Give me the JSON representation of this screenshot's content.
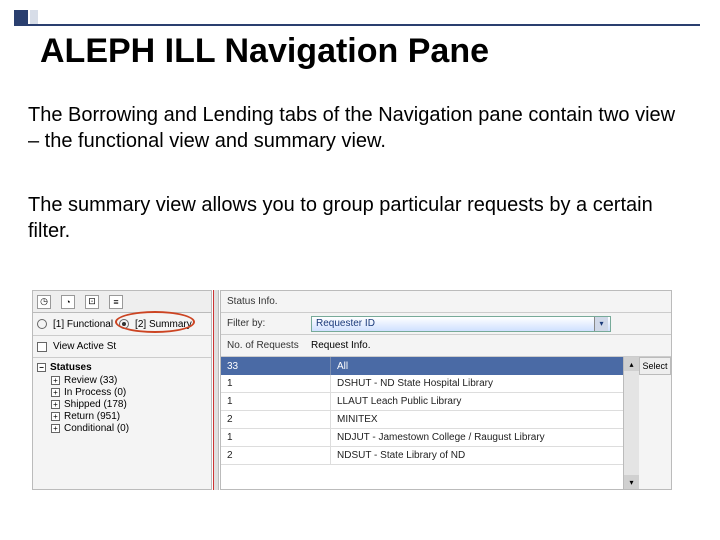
{
  "title": "ALEPH ILL  Navigation Pane",
  "paragraph1": "The Borrowing and Lending tabs of the Navigation pane contain two view – the functional view and summary view.",
  "paragraph2": "The summary view allows you to group particular requests by a certain filter.",
  "left": {
    "icons": [
      "◷",
      "◔",
      "⊡",
      "≡"
    ],
    "radio_functional": "[1] Functional",
    "radio_summary": "[2] Summary",
    "view_active": "View Active St",
    "tree_root": "Statuses",
    "tree_items": [
      "Review (33)",
      "In Process (0)",
      "Shipped (178)",
      "Return (951)",
      "Conditional (0)"
    ]
  },
  "right": {
    "status_label": "Status Info.",
    "filter_label": "Filter by:",
    "filter_value": "Requester ID",
    "header_a": "No. of Requests",
    "header_b": "Request Info.",
    "action": "Select",
    "rows": [
      {
        "a": "33",
        "b": "All"
      },
      {
        "a": "1",
        "b": "DSHUT - ND State Hospital Library"
      },
      {
        "a": "1",
        "b": "LLAUT    Leach Public Library"
      },
      {
        "a": "2",
        "b": "MINITEX"
      },
      {
        "a": "1",
        "b": "NDJUT - Jamestown College / Raugust Library"
      },
      {
        "a": "2",
        "b": "NDSUT - State Library of ND"
      }
    ]
  }
}
